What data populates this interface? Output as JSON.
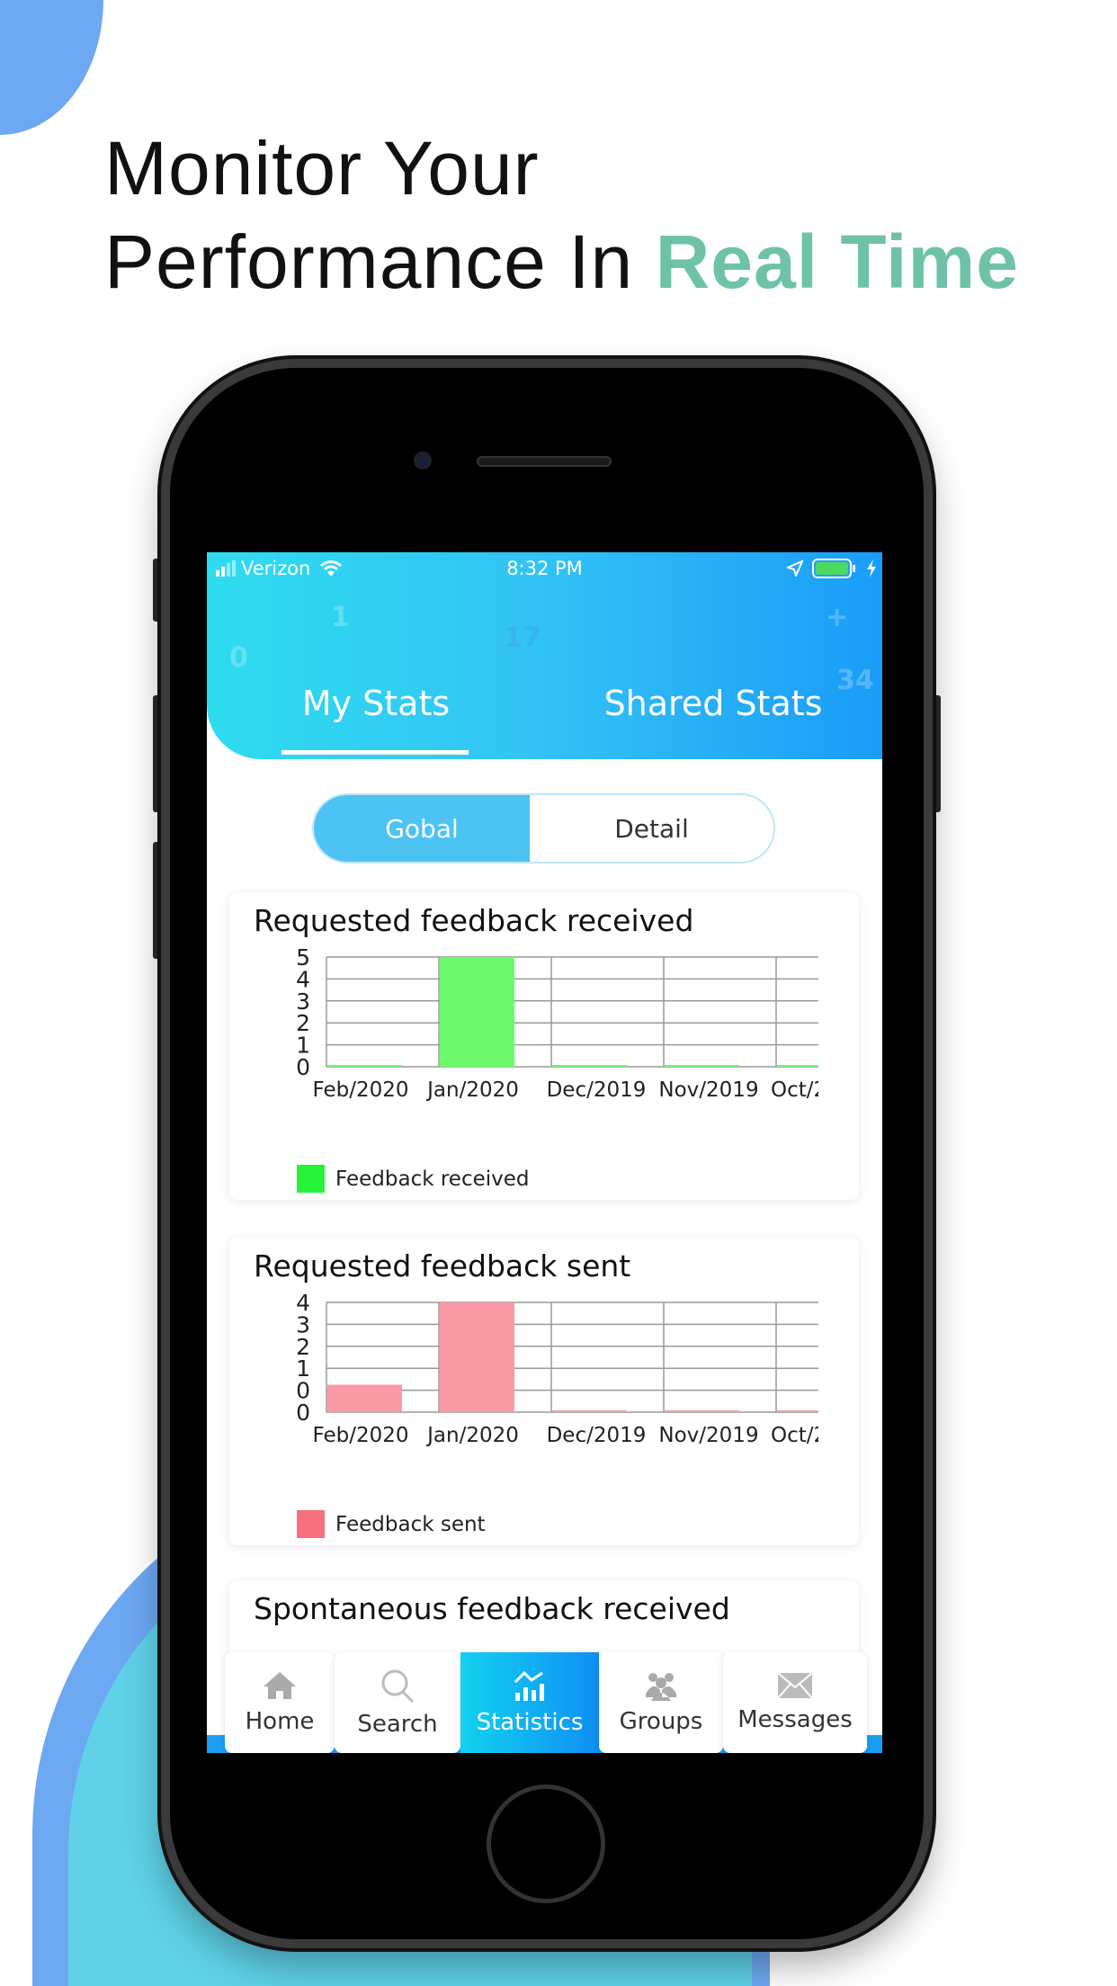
{
  "headline": {
    "line1": "Monitor Your",
    "line2_prefix": "Performance In ",
    "line2_accent": "Real Time"
  },
  "status_bar": {
    "carrier": "Verizon",
    "time": "8:32 PM"
  },
  "header": {
    "bg_numbers": [
      "0",
      "1",
      "17",
      "+",
      "34"
    ],
    "tabs": [
      {
        "label": "My Stats",
        "active": true
      },
      {
        "label": "Shared Stats",
        "active": false
      }
    ]
  },
  "segment": {
    "options": [
      "Gobal",
      "Detail"
    ],
    "selected": "Gobal"
  },
  "cards": [
    {
      "title": "Requested feedback received",
      "legend": "Feedback received"
    },
    {
      "title": "Requested feedback sent",
      "legend": "Feedback sent"
    },
    {
      "title": "Spontaneous feedback received"
    }
  ],
  "chart_data": [
    {
      "type": "bar",
      "title": "Requested feedback received",
      "categories": [
        "Feb/2020",
        "Jan/2020",
        "Dec/2019",
        "Nov/2019",
        "Oct/2"
      ],
      "series": [
        {
          "name": "Feedback received",
          "values": [
            0,
            5,
            0,
            0,
            0
          ]
        }
      ],
      "ytick_labels": [
        "5",
        "4",
        "3",
        "2",
        "1",
        "0"
      ],
      "ylim": [
        0,
        5
      ],
      "grid": true,
      "legend": "bottom-left",
      "color": "#6cfa6c",
      "legend_color": "#27f23a"
    },
    {
      "type": "bar",
      "title": "Requested feedback sent",
      "categories": [
        "Feb/2020",
        "Jan/2020",
        "Dec/2019",
        "Nov/2019",
        "Oct/2"
      ],
      "series": [
        {
          "name": "Feedback sent",
          "values": [
            1,
            4,
            0,
            0,
            0
          ]
        }
      ],
      "ytick_labels": [
        "4",
        "3",
        "2",
        "1",
        "0",
        "0"
      ],
      "ylim": [
        0,
        4
      ],
      "grid": true,
      "legend": "bottom-left",
      "color": "#fa9aa5",
      "legend_color": "#f6707f"
    }
  ],
  "tabbar": {
    "items": [
      {
        "label": "Home",
        "icon": "home-icon"
      },
      {
        "label": "Search",
        "icon": "search-icon"
      },
      {
        "label": "Statistics",
        "icon": "statistics-icon",
        "active": true
      },
      {
        "label": "Groups",
        "icon": "groups-icon"
      },
      {
        "label": "Messages",
        "icon": "envelope-icon"
      }
    ]
  },
  "colors": {
    "accent": "#6ec3a6",
    "header_start": "#2fdcef",
    "header_end": "#1a9cf8",
    "active_tab": "#0f8ff5"
  }
}
